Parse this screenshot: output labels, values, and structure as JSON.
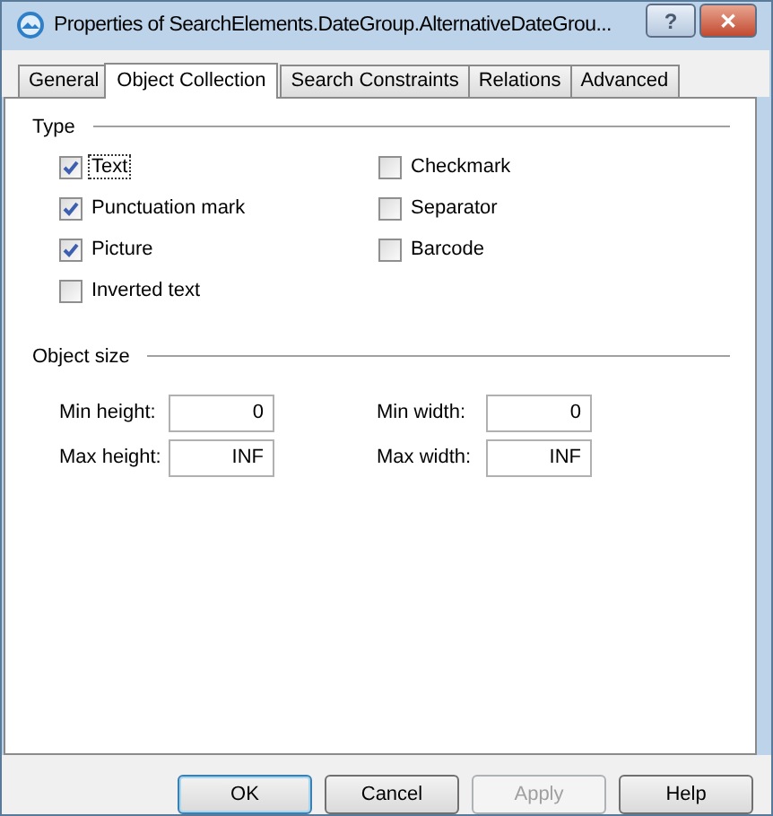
{
  "window": {
    "title": "Properties of SearchElements.DateGroup.AlternativeDateGrou..."
  },
  "title_buttons": [
    {
      "kind": "help",
      "label": "?"
    },
    {
      "kind": "close",
      "label": "✕"
    }
  ],
  "tabs": [
    {
      "label": "General",
      "selected": false
    },
    {
      "label": "Object Collection",
      "selected": true
    },
    {
      "label": "Search Constraints",
      "selected": false
    },
    {
      "label": "Relations",
      "selected": false
    },
    {
      "label": "Advanced",
      "selected": false
    }
  ],
  "type_group": {
    "title": "Type",
    "columns": [
      [
        {
          "label": "Text",
          "checked": true,
          "focused": true
        },
        {
          "label": "Punctuation mark",
          "checked": true,
          "focused": false
        },
        {
          "label": "Picture",
          "checked": true,
          "focused": false
        },
        {
          "label": "Inverted text",
          "checked": false,
          "focused": false
        }
      ],
      [
        {
          "label": "Checkmark",
          "checked": false,
          "focused": false
        },
        {
          "label": "Separator",
          "checked": false,
          "focused": false
        },
        {
          "label": "Barcode",
          "checked": false,
          "focused": false
        }
      ]
    ]
  },
  "size_group": {
    "title": "Object size",
    "columns": [
      [
        {
          "label": "Min height:",
          "value": "0"
        },
        {
          "label": "Max height:",
          "value": "INF"
        }
      ],
      [
        {
          "label": "Min width:",
          "value": "0"
        },
        {
          "label": "Max width:",
          "value": "INF"
        }
      ]
    ]
  },
  "buttons": [
    {
      "label": "OK",
      "disabled": false,
      "default": true
    },
    {
      "label": "Cancel",
      "disabled": false,
      "default": false
    },
    {
      "label": "Apply",
      "disabled": true,
      "default": false
    },
    {
      "label": "Help",
      "disabled": false,
      "default": false
    }
  ]
}
